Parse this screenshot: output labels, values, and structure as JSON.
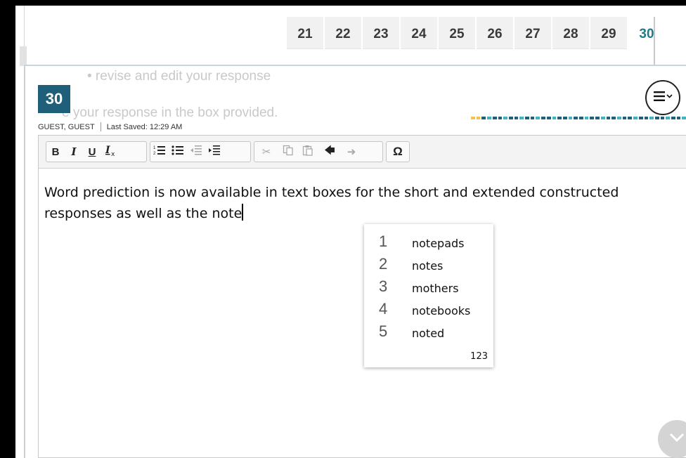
{
  "question_tabs": [
    "21",
    "22",
    "23",
    "24",
    "25",
    "26",
    "27",
    "28",
    "29",
    "30"
  ],
  "active_tab": "30",
  "instructions": {
    "line1": "• revise and edit your response",
    "line2": "e your response in the box provided."
  },
  "question_number": "30",
  "user": {
    "name": "GUEST, GUEST",
    "last_saved": "Last Saved: 12:29 AM"
  },
  "toolbar": {
    "bold": "B",
    "italic": "I",
    "underline": "U",
    "clear_format": "Tx",
    "special_char": "Ω"
  },
  "editor_text": "Word prediction is now available in text boxes for the short and extended constructed responses as well as the note",
  "suggestions": [
    {
      "num": "1",
      "word": "notepads"
    },
    {
      "num": "2",
      "word": "notes"
    },
    {
      "num": "3",
      "word": "mothers"
    },
    {
      "num": "4",
      "word": "notebooks"
    },
    {
      "num": "5",
      "word": "noted"
    }
  ],
  "suggestion_mode": "123",
  "colors": {
    "accent": "#1f5f7a",
    "progress_done": "#1f5f7a",
    "progress_todo": "#3fb5c4",
    "progress_current": "#f2c14e"
  },
  "icons": [
    "menu-hamburger-icon",
    "chevron-down-icon",
    "bold-icon",
    "italic-icon",
    "underline-icon",
    "clear-format-icon",
    "numbered-list-icon",
    "bulleted-list-icon",
    "outdent-icon",
    "indent-icon",
    "cut-icon",
    "copy-icon",
    "paste-icon",
    "undo-icon",
    "redo-icon",
    "special-character-icon"
  ]
}
